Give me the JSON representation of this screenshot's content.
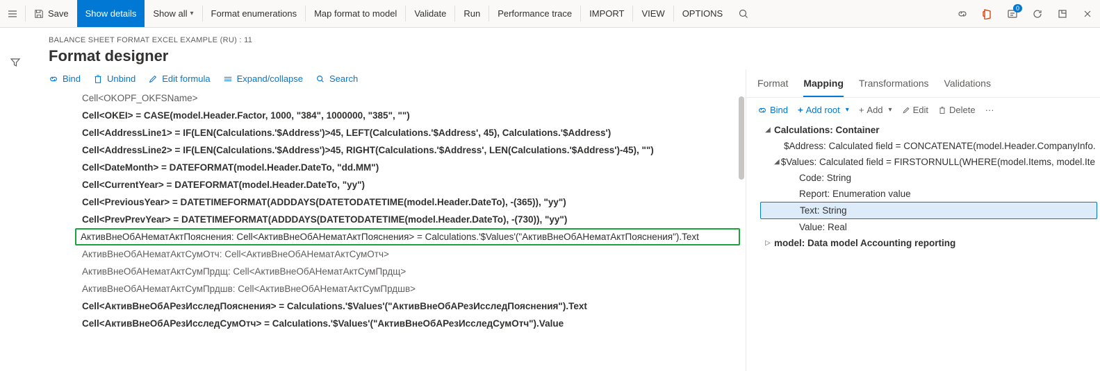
{
  "commandbar": {
    "save": "Save",
    "show_details": "Show details",
    "show_all": "Show all",
    "format_enum": "Format enumerations",
    "map_format": "Map format to model",
    "validate": "Validate",
    "run": "Run",
    "perf_trace": "Performance trace",
    "import": "IMPORT",
    "view": "VIEW",
    "options": "OPTIONS",
    "notif_count": "0"
  },
  "header": {
    "breadcrumb": "BALANCE SHEET FORMAT EXCEL EXAMPLE (RU) : 11",
    "title": "Format designer"
  },
  "left_toolbar": {
    "bind": "Bind",
    "unbind": "Unbind",
    "edit_formula": "Edit formula",
    "expand": "Expand/collapse",
    "search": "Search"
  },
  "format_rows": [
    {
      "text": "Cell<OKOPF_OKFSName>",
      "dim": true
    },
    {
      "text": "Cell<OKEI> = CASE(model.Header.Factor, 1000, \"384\", 1000000, \"385\", \"\")",
      "bold": true
    },
    {
      "text": "Cell<AddressLine1> = IF(LEN(Calculations.'$Address')>45, LEFT(Calculations.'$Address', 45), Calculations.'$Address')",
      "bold": true
    },
    {
      "text": "Cell<AddressLine2> = IF(LEN(Calculations.'$Address')>45, RIGHT(Calculations.'$Address', LEN(Calculations.'$Address')-45), \"\")",
      "bold": true
    },
    {
      "text": "Cell<DateMonth> = DATEFORMAT(model.Header.DateTo, \"dd.MM\")",
      "bold": true
    },
    {
      "text": "Cell<CurrentYear> = DATEFORMAT(model.Header.DateTo, \"yy\")",
      "bold": true
    },
    {
      "text": "Cell<PreviousYear> = DATETIMEFORMAT(ADDDAYS(DATETODATETIME(model.Header.DateTo), -(365)), \"yy\")",
      "bold": true
    },
    {
      "text": "Cell<PrevPrevYear> = DATETIMEFORMAT(ADDDAYS(DATETODATETIME(model.Header.DateTo), -(730)), \"yy\")",
      "bold": true
    },
    {
      "text": "АктивВнеОбАНематАктПояснения: Cell<АктивВнеОбАНематАктПояснения> = Calculations.'$Values'(\"АктивВнеОбАНематАктПояснения\").Text",
      "highlighted": true
    },
    {
      "text": "АктивВнеОбАНематАктСумОтч: Cell<АктивВнеОбАНематАктСумОтч>",
      "dim": true
    },
    {
      "text": "АктивВнеОбАНематАктСумПрдщ: Cell<АктивВнеОбАНематАктСумПрдщ>",
      "dim": true
    },
    {
      "text": "АктивВнеОбАНематАктСумПрдшв: Cell<АктивВнеОбАНематАктСумПрдшв>",
      "dim": true
    },
    {
      "text": "Cell<АктивВнеОбАРезИсследПояснения> = Calculations.'$Values'(\"АктивВнеОбАРезИсследПояснения\").Text",
      "bold": true
    },
    {
      "text": "Cell<АктивВнеОбАРезИсследСумОтч> = Calculations.'$Values'(\"АктивВнеОбАРезИсследСумОтч\").Value",
      "bold": true
    }
  ],
  "right": {
    "tabs": {
      "format": "Format",
      "mapping": "Mapping",
      "transformations": "Transformations",
      "validations": "Validations"
    },
    "toolbar": {
      "bind": "Bind",
      "add_root": "Add root",
      "add": "Add",
      "edit": "Edit",
      "delete": "Delete"
    },
    "tree": {
      "calc": "Calculations: Container",
      "address": "$Address: Calculated field = CONCATENATE(model.Header.CompanyInfo.",
      "values": "$Values: Calculated field = FIRSTORNULL(WHERE(model.Items, model.Ite",
      "code": "Code: String",
      "report": "Report: Enumeration value",
      "text": "Text: String",
      "value": "Value: Real",
      "model": "model: Data model Accounting reporting"
    }
  }
}
